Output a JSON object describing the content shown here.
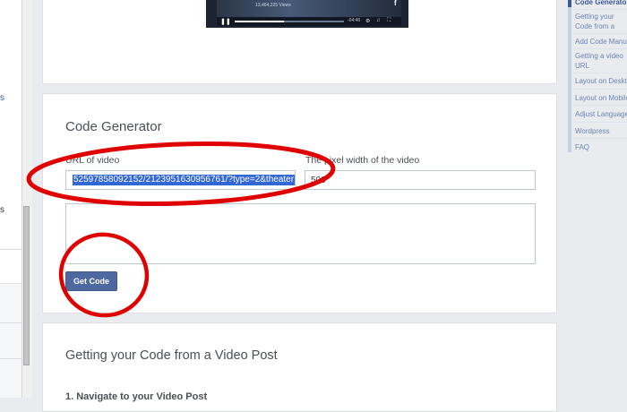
{
  "video": {
    "views": "13,464,225 Views",
    "time": "-04:46"
  },
  "generator": {
    "title": "Code Generator",
    "url_label": "URL of video",
    "url_value": "52597858092152/2123951630956761/?type=2&theater",
    "width_label": "The pixel width of the video",
    "width_value": "500",
    "button_label": "Get Code"
  },
  "post_section": {
    "title": "Getting your Code from a Video Post",
    "step1": "1. Navigate to your Video Post"
  },
  "right_nav": {
    "items": [
      {
        "label": "Code Generator"
      },
      {
        "label": "Getting your Code from a Video Post"
      },
      {
        "label": "Add Code Manually"
      },
      {
        "label": "Getting a video URL"
      },
      {
        "label": "Layout on Desktop"
      },
      {
        "label": "Layout on Mobile"
      },
      {
        "label": "Adjust Language"
      },
      {
        "label": "Wordpress"
      },
      {
        "label": "FAQ"
      }
    ]
  },
  "left_sidebar": {
    "link_fragment": "s",
    "text_fragment": "s"
  },
  "colors": {
    "annotation": "#e00000",
    "button": "#4e69a2",
    "link": "#6d84b4"
  }
}
